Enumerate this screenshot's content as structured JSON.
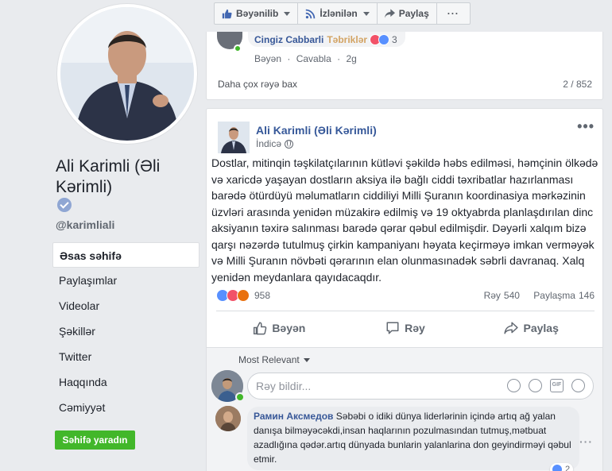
{
  "page": {
    "name": "Ali Karimli (Əli Kərimli)",
    "handle": "@karimliali",
    "create_page_label": "Səhifə yaradın"
  },
  "nav": {
    "items": [
      {
        "label": "Əsas səhifə",
        "active": true
      },
      {
        "label": "Paylaşımlar"
      },
      {
        "label": "Videolar"
      },
      {
        "label": "Şəkillər"
      },
      {
        "label": "Twitter"
      },
      {
        "label": "Haqqında"
      },
      {
        "label": "Cəmiyyət"
      }
    ]
  },
  "actionbar": {
    "liked_label": "Bəyənilib",
    "following_label": "İzlənilən",
    "share_label": "Paylaş",
    "more_label": "···"
  },
  "prev_post": {
    "comment_author": "Cingiz Cabbarli",
    "comment_text": "Təbriklər",
    "comment_reactions": "3",
    "like_label": "Bəyən",
    "reply_label": "Cavabla",
    "separator": "·",
    "time": "2g",
    "more_comments_label": "Daha çox rəyə bax",
    "comment_counter": "2 / 852"
  },
  "post": {
    "author": "Ali Karimli (Əli Kərimli)",
    "time": "İndicə",
    "more_label": "•••",
    "body": "Dostlar, mitinqin təşkilatçılarının kütləvi şəkildə həbs edilməsi, həmçinin ölkədə və xaricdə yaşayan dostların aksiya ilə bağlı ciddi təxribatlar hazırlanması barədə ötürdüyü məlumatların ciddiliyi Milli Şuranın koordinasiya mərkəzinin üzvləri arasında yenidən müzakirə edilmiş və 19 oktyabrda planlaşdırılan dinc aksiyanın təxirə salınması barədə qərar qəbul edilmişdir. Dəyərli xalqım bizə qarşı nəzərdə tutulmuş çirkin kampaniyanı həyata keçirməyə imkan verməyək və Milli Şuranın növbəti qərarının elan olunmasınadək səbrli davranaq. Xalq yenidən meydanlara qayıdacaqdır.",
    "reactions_count": "958",
    "comments_label": "Rəy",
    "comments_count": "540",
    "shares_label": "Paylaşma",
    "shares_count": "146",
    "like_label": "Bəyən",
    "comment_label": "Rəy",
    "share_label": "Paylaş"
  },
  "comments": {
    "sort_label": "Most Relevant",
    "input_placeholder": "Rəy bildir...",
    "input_value": "",
    "gif_label": "GIF",
    "items": [
      {
        "author": "Рамин Аксмедов",
        "text": "Səbəbi o idiki dünya liderlərinin içində artıq ağ yalan danışa bilməyəcəkdi,insan haqlarının pozulmasından tutmuş,mətbuat azadlığına qədər.artıq dünyada bunlarin yalanlarina don geyindirməyi qəbul etmir.",
        "reactions": "2"
      }
    ]
  },
  "colors": {
    "link": "#385898",
    "green": "#42b72a",
    "like_blue": "#5890ff",
    "love_red": "#f25268",
    "angry_orange": "#e9710f"
  }
}
